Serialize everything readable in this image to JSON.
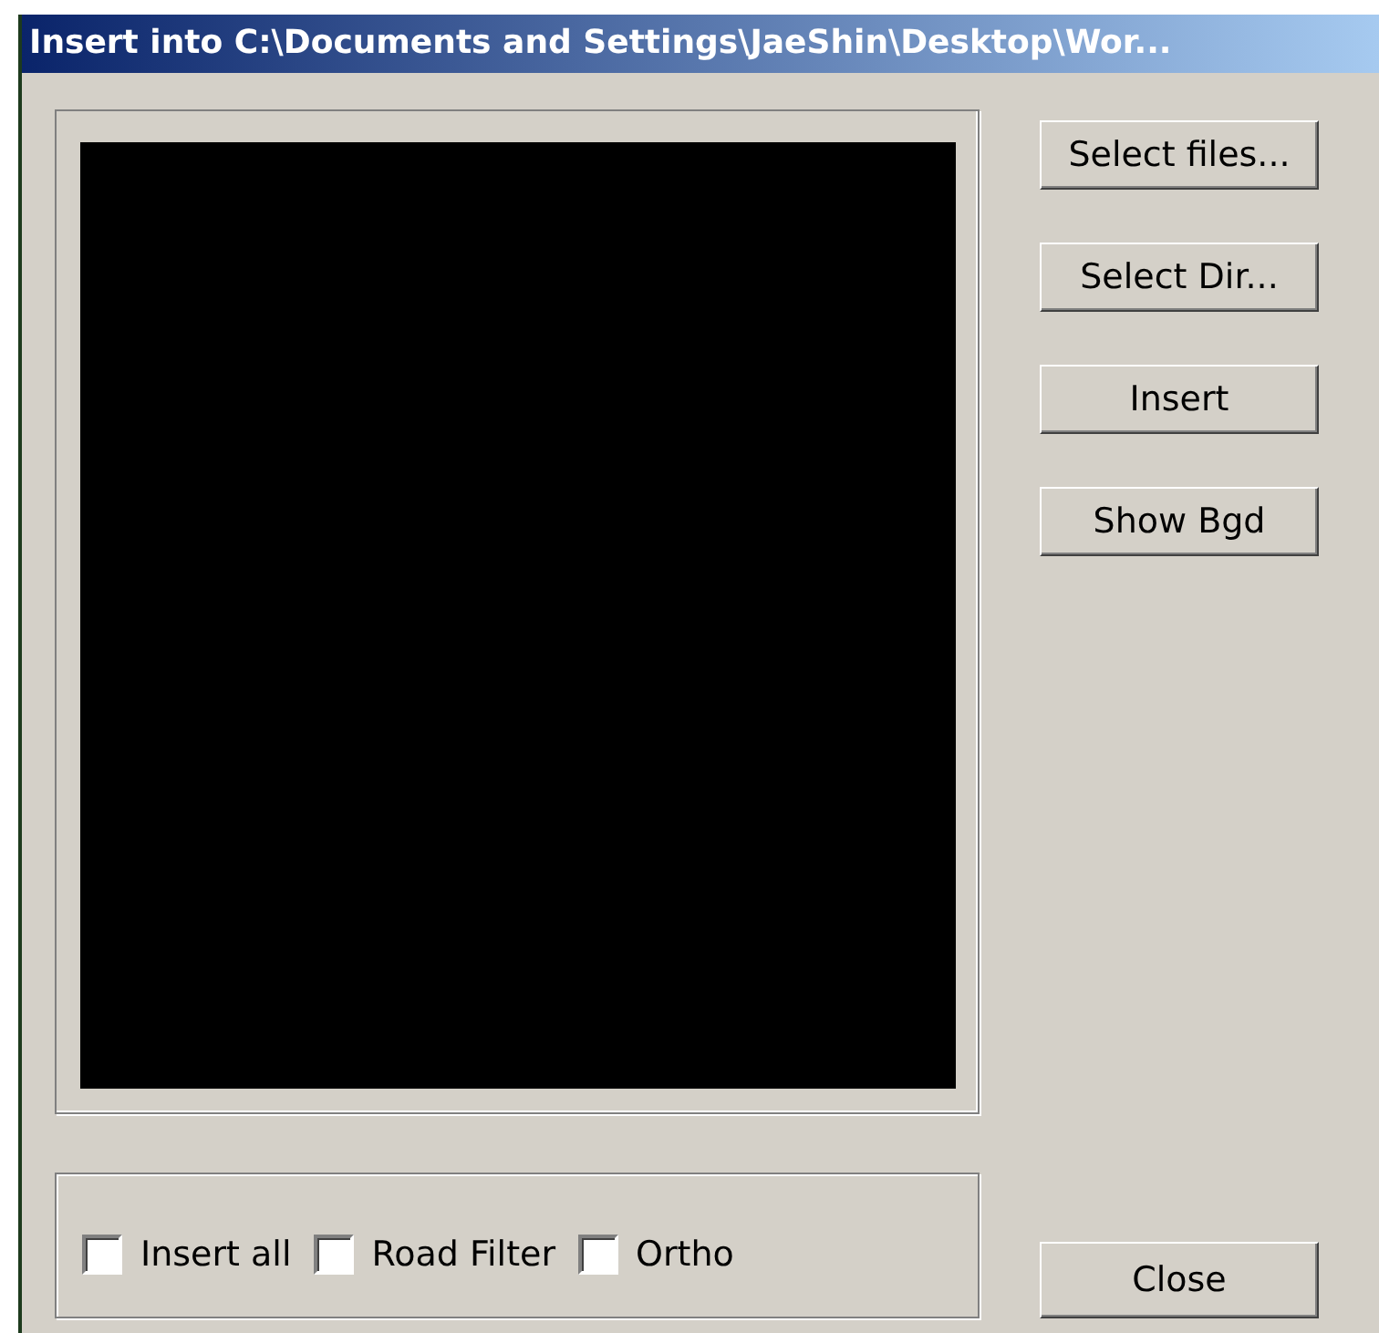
{
  "window": {
    "title": "Insert into C:\\Documents and Settings\\JaeShin\\Desktop\\Wor..."
  },
  "buttons": [
    "Select files...",
    "Select Dir...",
    "Insert",
    "Show Bgd"
  ],
  "options": [
    {
      "label": "Insert all",
      "checked": false
    },
    {
      "label": "Road Filter",
      "checked": false
    },
    {
      "label": "Ortho",
      "checked": false
    }
  ],
  "close_button": "Close"
}
